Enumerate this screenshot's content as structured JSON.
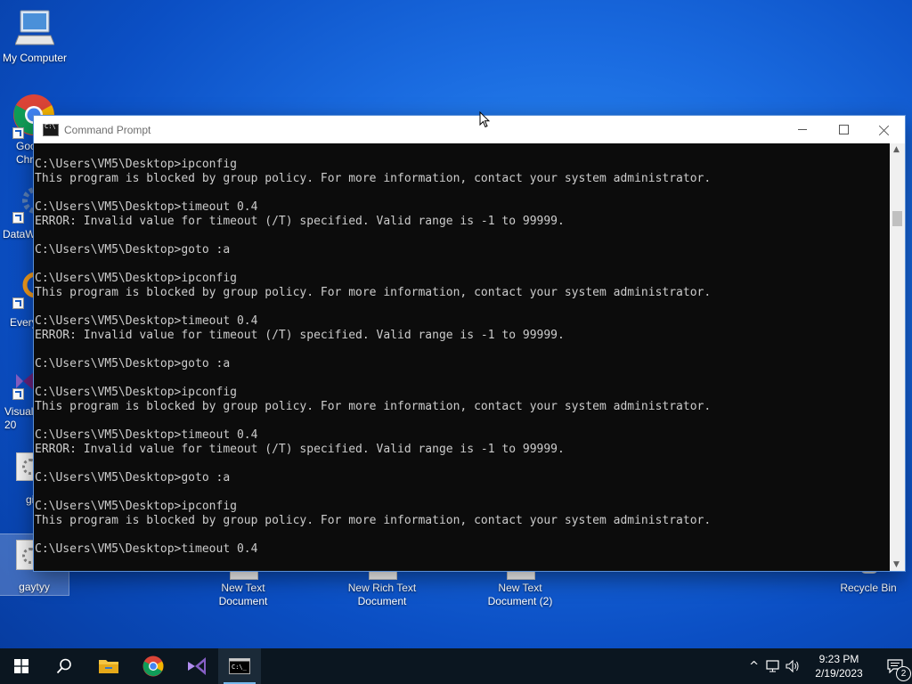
{
  "desktop": {
    "icons": [
      {
        "label": "My Computer"
      },
      {
        "label": "Goo\nChr"
      },
      {
        "label": "DataW"
      },
      {
        "label": "Every"
      },
      {
        "label": "Visual\n20"
      },
      {
        "label": "gi"
      },
      {
        "label": "gaytyy"
      },
      {
        "label": "New Text\nDocument"
      },
      {
        "label": "New Rich Text\nDocument"
      },
      {
        "label": "New Text\nDocument (2)"
      },
      {
        "label": "Recycle Bin"
      }
    ]
  },
  "window": {
    "title": "Command Prompt",
    "lines": [
      "C:\\Users\\VM5\\Desktop>ipconfig",
      "This program is blocked by group policy. For more information, contact your system administrator.",
      "",
      "C:\\Users\\VM5\\Desktop>timeout 0.4",
      "ERROR: Invalid value for timeout (/T) specified. Valid range is -1 to 99999.",
      "",
      "C:\\Users\\VM5\\Desktop>goto :a",
      "",
      "C:\\Users\\VM5\\Desktop>ipconfig",
      "This program is blocked by group policy. For more information, contact your system administrator.",
      "",
      "C:\\Users\\VM5\\Desktop>timeout 0.4",
      "ERROR: Invalid value for timeout (/T) specified. Valid range is -1 to 99999.",
      "",
      "C:\\Users\\VM5\\Desktop>goto :a",
      "",
      "C:\\Users\\VM5\\Desktop>ipconfig",
      "This program is blocked by group policy. For more information, contact your system administrator.",
      "",
      "C:\\Users\\VM5\\Desktop>timeout 0.4",
      "ERROR: Invalid value for timeout (/T) specified. Valid range is -1 to 99999.",
      "",
      "C:\\Users\\VM5\\Desktop>goto :a",
      "",
      "C:\\Users\\VM5\\Desktop>ipconfig",
      "This program is blocked by group policy. For more information, contact your system administrator.",
      "",
      "C:\\Users\\VM5\\Desktop>timeout 0.4"
    ]
  },
  "taskbar": {
    "icons": [
      "windows-start-icon",
      "search-icon",
      "file-explorer-icon",
      "chrome-icon",
      "visual-studio-icon",
      "command-prompt-icon"
    ],
    "clock": {
      "time": "9:23 PM",
      "date": "2/19/2023"
    },
    "notification_count": "2"
  },
  "colors": {
    "terminal_bg": "#0c0c0c",
    "terminal_fg": "#cccccc",
    "taskbar_bg": "#0b1620",
    "desktop_blue": "#1a6be0"
  }
}
